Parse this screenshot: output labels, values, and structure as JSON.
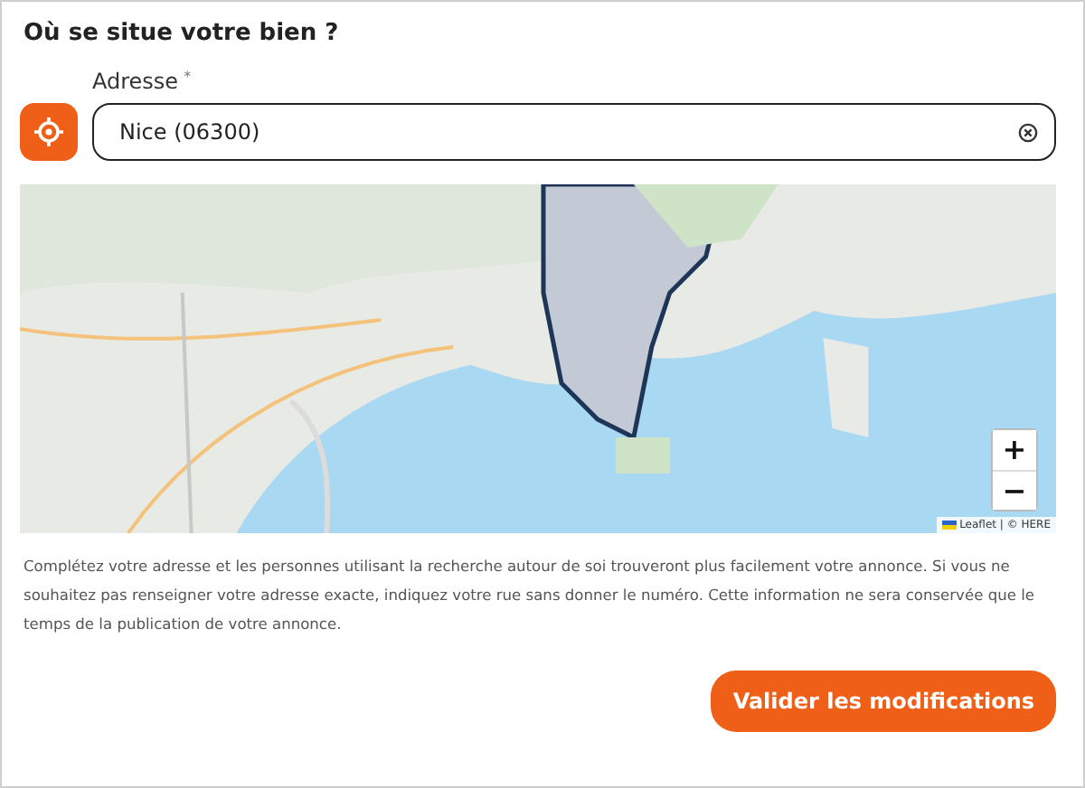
{
  "title": "Où se situe votre bien ?",
  "address": {
    "label": "Adresse",
    "required_mark": "*",
    "value": "Nice (06300)"
  },
  "map": {
    "zoom_in": "+",
    "zoom_out": "−",
    "attribution": "Leaflet | © HERE"
  },
  "help_text": "Complétez votre adresse et les personnes utilisant la recherche autour de soi trouveront plus facilement votre annonce. Si vous ne souhaitez pas renseigner votre adresse exacte, indiquez votre rue sans donner le numéro. Cette information ne sera conservée que le temps de la publication de votre annonce.",
  "submit_button": "Valider les modifications"
}
